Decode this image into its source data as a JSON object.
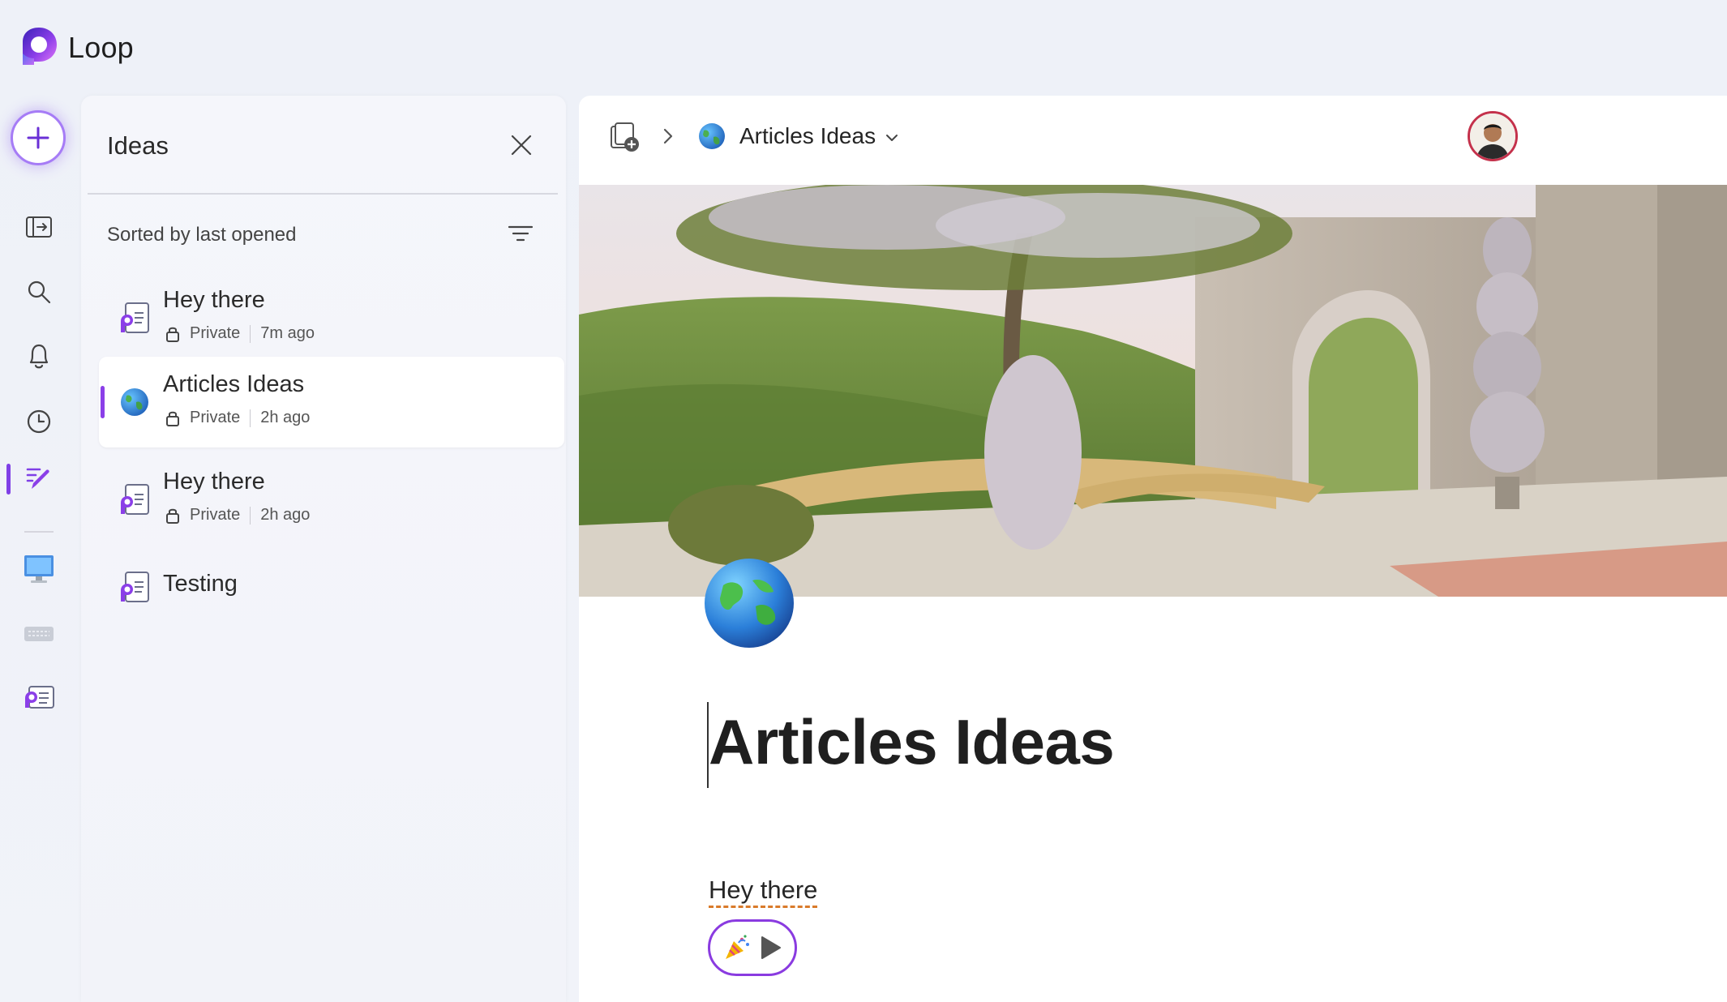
{
  "app": {
    "title": "Loop"
  },
  "rail": {
    "items": [
      {
        "name": "new-button",
        "icon": "plus-icon"
      },
      {
        "name": "open-workspace-button",
        "icon": "panel-arrow-icon"
      },
      {
        "name": "search-button",
        "icon": "search-icon"
      },
      {
        "name": "notifications-button",
        "icon": "bell-icon"
      },
      {
        "name": "recent-button",
        "icon": "clock-icon"
      },
      {
        "name": "ideas-button",
        "icon": "pencil-icon",
        "active": true
      },
      {
        "name": "workspace-monitor",
        "icon": "monitor-icon"
      },
      {
        "name": "workspace-keyboard",
        "icon": "keyboard-icon"
      },
      {
        "name": "workspace-loop",
        "icon": "loop-page-icon"
      }
    ]
  },
  "panel": {
    "title": "Ideas",
    "sort_label": "Sorted by last opened",
    "items": [
      {
        "name": "Hey there",
        "visibility": "Private",
        "time": "7m ago",
        "icon": "loop-page-icon"
      },
      {
        "name": "Articles Ideas",
        "visibility": "Private",
        "time": "2h ago",
        "icon": "globe-icon",
        "active": true
      },
      {
        "name": "Hey there",
        "visibility": "Private",
        "time": "2h ago",
        "icon": "loop-page-icon"
      },
      {
        "name": "Testing",
        "icon": "loop-page-icon"
      }
    ]
  },
  "doc": {
    "breadcrumb_title": "Articles Ideas",
    "title": "Articles Ideas",
    "body_text": "Hey there",
    "reaction_icons": [
      "party-popper-icon",
      "play-icon"
    ]
  },
  "colors": {
    "accent": "#8b3fe8",
    "avatar_ring": "#c4314b",
    "spell_underline": "#d97b2b"
  }
}
